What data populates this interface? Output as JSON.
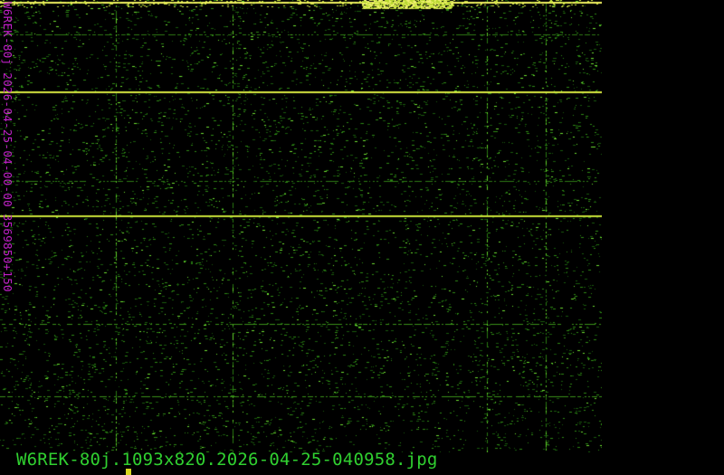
{
  "spectrogram": {
    "side_label": "W6REK-80j 2026-04-25-04-00-00 3569850+150",
    "filename": "W6REK-80j.1093x820.2026-04-25-040958.jpg",
    "colors": {
      "background": "#000000",
      "signal": "#4ad020",
      "strong_signal": "#e8f040",
      "label": "#c020c8",
      "filename": "#30d030",
      "marker": "#d8d820"
    }
  }
}
